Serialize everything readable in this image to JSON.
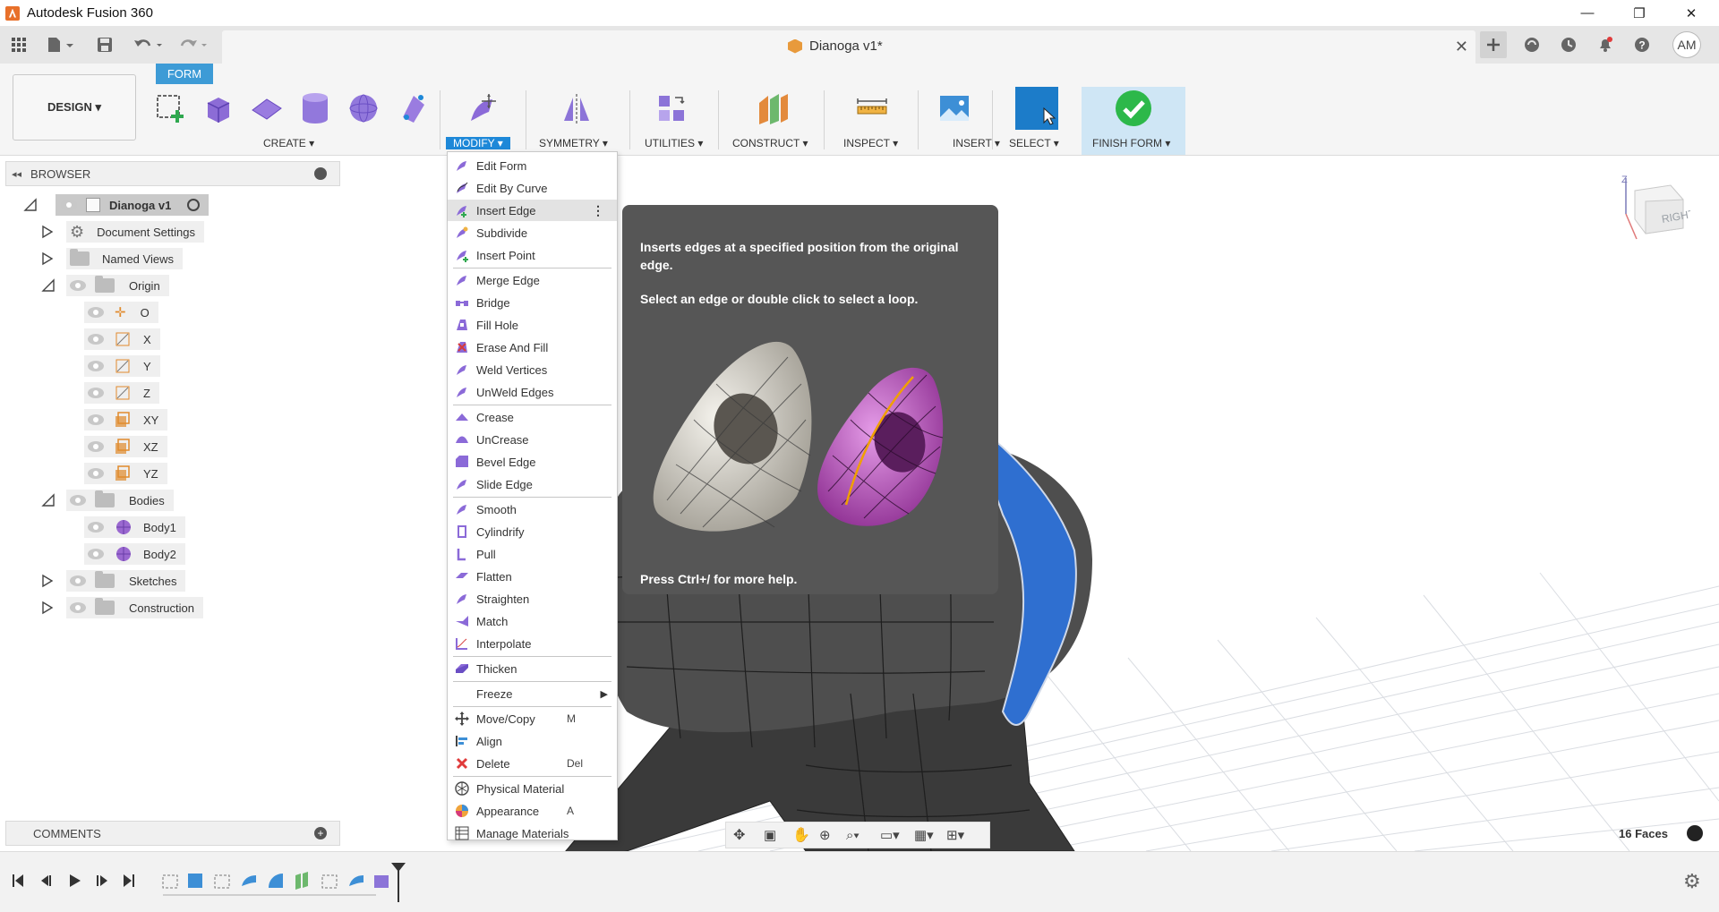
{
  "window": {
    "title": "Autodesk Fusion 360",
    "minimize": "—",
    "restore": "❐",
    "close": "✕"
  },
  "tab": {
    "document_title": "Dianoga v1*",
    "close": "✕"
  },
  "user": {
    "initials": "AM"
  },
  "workspace": {
    "label": "DESIGN ▾"
  },
  "toolbar": {
    "active_tab": "FORM",
    "groups": {
      "create": "CREATE ▾",
      "modify": "MODIFY ▾",
      "symmetry": "SYMMETRY ▾",
      "utilities": "UTILITIES ▾",
      "construct": "CONSTRUCT ▾",
      "inspect": "INSPECT ▾",
      "insert": "INSERT ▾",
      "select": "SELECT ▾",
      "finish_form": "FINISH FORM ▾"
    }
  },
  "browser": {
    "title": "BROWSER",
    "root": "Dianoga v1",
    "items": [
      "Document Settings",
      "Named Views",
      "Origin",
      "O",
      "X",
      "Y",
      "Z",
      "XY",
      "XZ",
      "YZ",
      "Bodies",
      "Body1",
      "Body2",
      "Sketches",
      "Construction"
    ]
  },
  "comments": {
    "title": "COMMENTS"
  },
  "modify_menu": {
    "items": [
      {
        "label": "Edit Form",
        "shortcut": ""
      },
      {
        "label": "Edit By Curve",
        "shortcut": ""
      },
      {
        "label": "Insert Edge",
        "shortcut": ""
      },
      {
        "label": "Subdivide",
        "shortcut": ""
      },
      {
        "label": "Insert Point",
        "shortcut": ""
      },
      {
        "label": "Merge Edge",
        "shortcut": ""
      },
      {
        "label": "Bridge",
        "shortcut": ""
      },
      {
        "label": "Fill Hole",
        "shortcut": ""
      },
      {
        "label": "Erase And Fill",
        "shortcut": ""
      },
      {
        "label": "Weld Vertices",
        "shortcut": ""
      },
      {
        "label": "UnWeld Edges",
        "shortcut": ""
      },
      {
        "label": "Crease",
        "shortcut": ""
      },
      {
        "label": "UnCrease",
        "shortcut": ""
      },
      {
        "label": "Bevel Edge",
        "shortcut": ""
      },
      {
        "label": "Slide Edge",
        "shortcut": ""
      },
      {
        "label": "Smooth",
        "shortcut": ""
      },
      {
        "label": "Cylindrify",
        "shortcut": ""
      },
      {
        "label": "Pull",
        "shortcut": ""
      },
      {
        "label": "Flatten",
        "shortcut": ""
      },
      {
        "label": "Straighten",
        "shortcut": ""
      },
      {
        "label": "Match",
        "shortcut": ""
      },
      {
        "label": "Interpolate",
        "shortcut": ""
      },
      {
        "label": "Thicken",
        "shortcut": ""
      },
      {
        "label": "Freeze",
        "shortcut": ""
      },
      {
        "label": "Move/Copy",
        "shortcut": "M"
      },
      {
        "label": "Align",
        "shortcut": ""
      },
      {
        "label": "Delete",
        "shortcut": "Del"
      },
      {
        "label": "Physical Material",
        "shortcut": ""
      },
      {
        "label": "Appearance",
        "shortcut": "A"
      },
      {
        "label": "Manage Materials",
        "shortcut": ""
      }
    ],
    "highlighted": "Insert Edge"
  },
  "tooltip": {
    "description": "Inserts edges at a specified position from the original edge.",
    "instruction": "Select an edge or double click to select a loop.",
    "help": "Press Ctrl+/ for more help."
  },
  "viewcube": {
    "face": "RIGHT",
    "axis_z": "Z"
  },
  "status": {
    "faces": "16 Faces"
  },
  "colors": {
    "accent": "#1e88d8",
    "form_tab": "#3d9bd6",
    "finish_form_bg": "#cfe6f5",
    "tooltip_bg": "#565656",
    "body_blue": "#2f6fd0"
  }
}
